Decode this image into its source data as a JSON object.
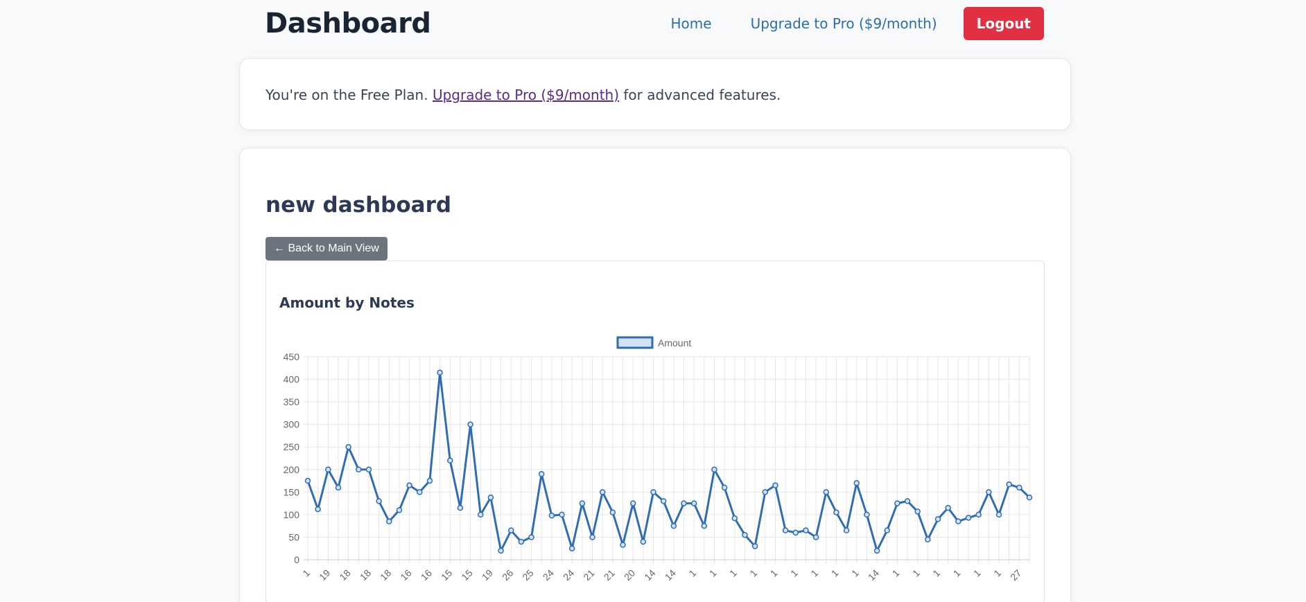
{
  "header": {
    "title": "Dashboard",
    "nav_home": "Home",
    "nav_upgrade": "Upgrade to Pro ($9/month)",
    "logout": "Logout"
  },
  "plan_notice": {
    "prefix": "You're on the Free Plan. ",
    "link": "Upgrade to Pro ($9/month)",
    "suffix": " for advanced features."
  },
  "dashboard": {
    "title": "new dashboard",
    "back_button": "← Back to Main View"
  },
  "colors": {
    "accent": "#2b6cb0",
    "logout": "#e03042",
    "line": "#2e6db4",
    "fill": "#d3e3f5"
  },
  "chart_data": {
    "type": "line",
    "title": "Amount by Notes",
    "legend": "top",
    "grid": true,
    "ylim": [
      0,
      450
    ],
    "yticks": [
      0,
      50,
      100,
      150,
      200,
      250,
      300,
      350,
      400,
      450
    ],
    "categories": [
      "1",
      "",
      "19",
      "",
      "18",
      "",
      "18",
      "",
      "18",
      "",
      "16",
      "",
      "16",
      "",
      "15",
      "",
      "15",
      "",
      "19",
      "",
      "26",
      "",
      "25",
      "",
      "24",
      "",
      "24",
      "",
      "21",
      "",
      "21",
      "",
      "20",
      "",
      "14",
      "",
      "14",
      "",
      "1",
      "",
      "1",
      "",
      "1",
      "",
      "1",
      "",
      "1",
      "",
      "1",
      "",
      "1",
      "",
      "1",
      "",
      "1",
      "",
      "14",
      "",
      "1",
      "",
      "1",
      "",
      "1",
      "",
      "1",
      "",
      "1",
      "",
      "1",
      "",
      "27",
      ""
    ],
    "series": [
      {
        "name": "Amount",
        "values": [
          175,
          112,
          200,
          160,
          250,
          200,
          200,
          130,
          85,
          110,
          165,
          150,
          175,
          415,
          220,
          115,
          300,
          100,
          138,
          20,
          65,
          40,
          50,
          190,
          98,
          100,
          25,
          125,
          50,
          150,
          105,
          33,
          125,
          40,
          150,
          130,
          75,
          125,
          125,
          75,
          200,
          160,
          92,
          55,
          30,
          150,
          165,
          65,
          60,
          65,
          50,
          150,
          105,
          65,
          170,
          100,
          20,
          65,
          125,
          130,
          107,
          45,
          90,
          115,
          85,
          93,
          100,
          150,
          100,
          167,
          160,
          138
        ]
      }
    ]
  }
}
